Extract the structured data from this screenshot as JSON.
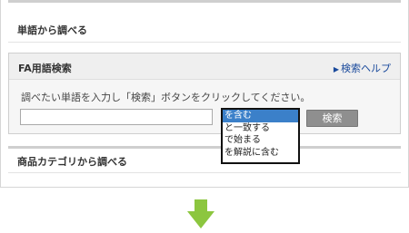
{
  "sections": {
    "word_search": {
      "title": "単語から調べる"
    },
    "category_search": {
      "title": "商品カテゴリから調べる"
    }
  },
  "fa_search": {
    "title": "FA用語検索",
    "help_link": "検索ヘルプ",
    "instruction": "調べたい単語を入力し「検索」ボタンをクリックしてください。",
    "input_value": "",
    "dropdown_options": [
      "を含む",
      "と一致する",
      "で始まる",
      "を解説に含む"
    ],
    "selected_option": "を含む",
    "search_button": "検索"
  },
  "colors": {
    "link": "#1a4a9c",
    "selection": "#3b80c9",
    "arrow": "#8cc63f"
  },
  "icons": {
    "help_arrow": "triangle-right-icon",
    "next_step": "down-arrow-icon"
  }
}
